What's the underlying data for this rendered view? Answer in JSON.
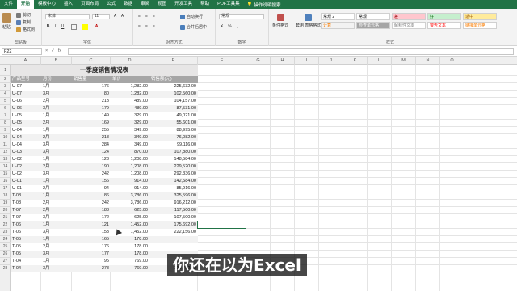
{
  "menu": {
    "tabs": [
      "文件",
      "开始",
      "模板中心",
      "插入",
      "页面布局",
      "公式",
      "数据",
      "审阅",
      "视图",
      "开发工具",
      "帮助",
      "PDF工具集"
    ],
    "active_tab": "开始",
    "tell_me": "操作说明搜索"
  },
  "ribbon": {
    "clipboard": {
      "paste": "粘贴",
      "cut": "剪切",
      "copy": "复制",
      "format_painter": "格式刷",
      "label": "剪贴板"
    },
    "font": {
      "font_name": "宋体",
      "font_size": "11",
      "label": "字体"
    },
    "alignment": {
      "wrap": "自动换行",
      "merge": "合并后居中",
      "label": "对齐方式"
    },
    "number": {
      "format": "常规",
      "label": "数字"
    },
    "styles": {
      "conditional": "条件格式",
      "table_format": "套用\n表格格式",
      "label": "样式",
      "cells": [
        "常规 2",
        "常规",
        "差",
        "好",
        "适中",
        "计算",
        "检查单元格",
        "解释性文本",
        "警告文本",
        "链接单元格"
      ]
    }
  },
  "formula_bar": {
    "name_box": "F22",
    "fx": "fx",
    "formula": ""
  },
  "columns": [
    "A",
    "B",
    "C",
    "D",
    "E",
    "F",
    "G",
    "H",
    "I",
    "J",
    "K",
    "L",
    "M",
    "N",
    "O"
  ],
  "rows": [
    "1",
    "2",
    "3",
    "4",
    "5",
    "6",
    "7",
    "8",
    "9",
    "10",
    "11",
    "12",
    "13",
    "14",
    "15",
    "16",
    "17",
    "18",
    "19",
    "20",
    "21",
    "22",
    "23",
    "24",
    "25",
    "26",
    "27",
    "28"
  ],
  "sheet": {
    "title": "一季度销售情况表",
    "headers": [
      "产品型号",
      "月份",
      "销售量",
      "单价",
      "销售额(元)"
    ],
    "data": [
      [
        "U-07",
        "1月",
        "176",
        "1,282.00",
        "225,632.00"
      ],
      [
        "U-07",
        "3月",
        "80",
        "1,282.00",
        "102,560.00"
      ],
      [
        "U-06",
        "2月",
        "213",
        "489.00",
        "104,157.00"
      ],
      [
        "U-06",
        "3月",
        "179",
        "489.00",
        "87,531.00"
      ],
      [
        "U-05",
        "1月",
        "149",
        "329.00",
        "49,021.00"
      ],
      [
        "U-05",
        "2月",
        "169",
        "329.00",
        "55,601.00"
      ],
      [
        "U-04",
        "1月",
        "255",
        "349.00",
        "88,995.00"
      ],
      [
        "U-04",
        "2月",
        "218",
        "349.00",
        "76,082.00"
      ],
      [
        "U-04",
        "3月",
        "284",
        "349.00",
        "99,116.00"
      ],
      [
        "U-03",
        "3月",
        "124",
        "870.00",
        "107,880.00"
      ],
      [
        "U-02",
        "1月",
        "123",
        "1,208.00",
        "148,584.00"
      ],
      [
        "U-02",
        "2月",
        "190",
        "1,208.00",
        "229,520.00"
      ],
      [
        "U-02",
        "3月",
        "242",
        "1,208.00",
        "292,336.00"
      ],
      [
        "U-01",
        "1月",
        "156",
        "914.00",
        "142,584.00"
      ],
      [
        "U-01",
        "2月",
        "94",
        "914.00",
        "85,916.00"
      ],
      [
        "T-08",
        "1月",
        "86",
        "3,786.00",
        "325,596.00"
      ],
      [
        "T-08",
        "2月",
        "242",
        "3,786.00",
        "916,212.00"
      ],
      [
        "T-07",
        "2月",
        "188",
        "625.00",
        "117,500.00"
      ],
      [
        "T-07",
        "3月",
        "172",
        "625.00",
        "107,500.00"
      ],
      [
        "T-06",
        "1月",
        "121",
        "1,452.00",
        "175,692.00"
      ],
      [
        "T-06",
        "3月",
        "153",
        "1,452.00",
        "222,156.00"
      ],
      [
        "T-05",
        "1月",
        "165",
        "178.00",
        ""
      ],
      [
        "T-05",
        "2月",
        "176",
        "178.00",
        ""
      ],
      [
        "T-05",
        "3月",
        "177",
        "178.00",
        ""
      ],
      [
        "T-04",
        "1月",
        "95",
        "769.00",
        ""
      ],
      [
        "T-04",
        "3月",
        "278",
        "769.00",
        "213,782.00"
      ]
    ]
  },
  "caption": "你还在以为Excel",
  "colors": {
    "accent": "#217346",
    "header_fill": "#a6a6a6",
    "title_fill": "#e7e6e6",
    "stripe": "#f2f2f2",
    "selection": "#217346",
    "bad": "#ffc7ce",
    "good": "#c6efce",
    "neutral": "#ffeb9c"
  }
}
